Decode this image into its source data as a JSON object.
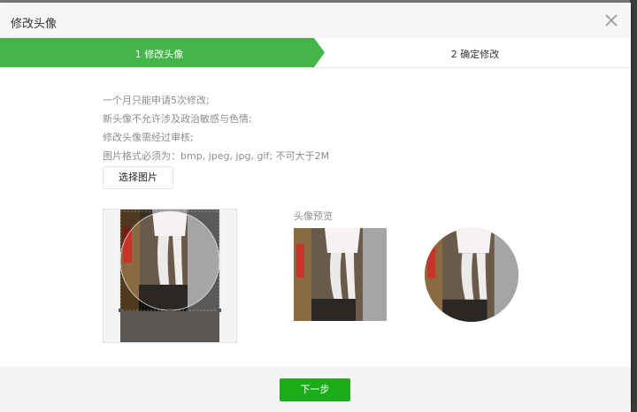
{
  "dialog": {
    "title": "修改头像"
  },
  "steps": [
    {
      "label": "1 修改头像",
      "active": true
    },
    {
      "label": "2 确定修改",
      "active": false
    }
  ],
  "instructions": [
    "一个月只能申请5次修改;",
    "新头像不允许涉及政治敏感与色情;",
    "修改头像需经过审核;",
    "图片格式必须为：bmp, jpeg, jpg, gif; 不可大于2M"
  ],
  "select_button": {
    "label": "选择图片"
  },
  "preview": {
    "label": "头像预览"
  },
  "footer": {
    "next_label": "下一步"
  },
  "colors": {
    "accent": "#1aad19",
    "header_bg": "#f6f6f9",
    "footer_bg": "#f4f4f6"
  },
  "icons": {
    "close": "close-icon"
  }
}
